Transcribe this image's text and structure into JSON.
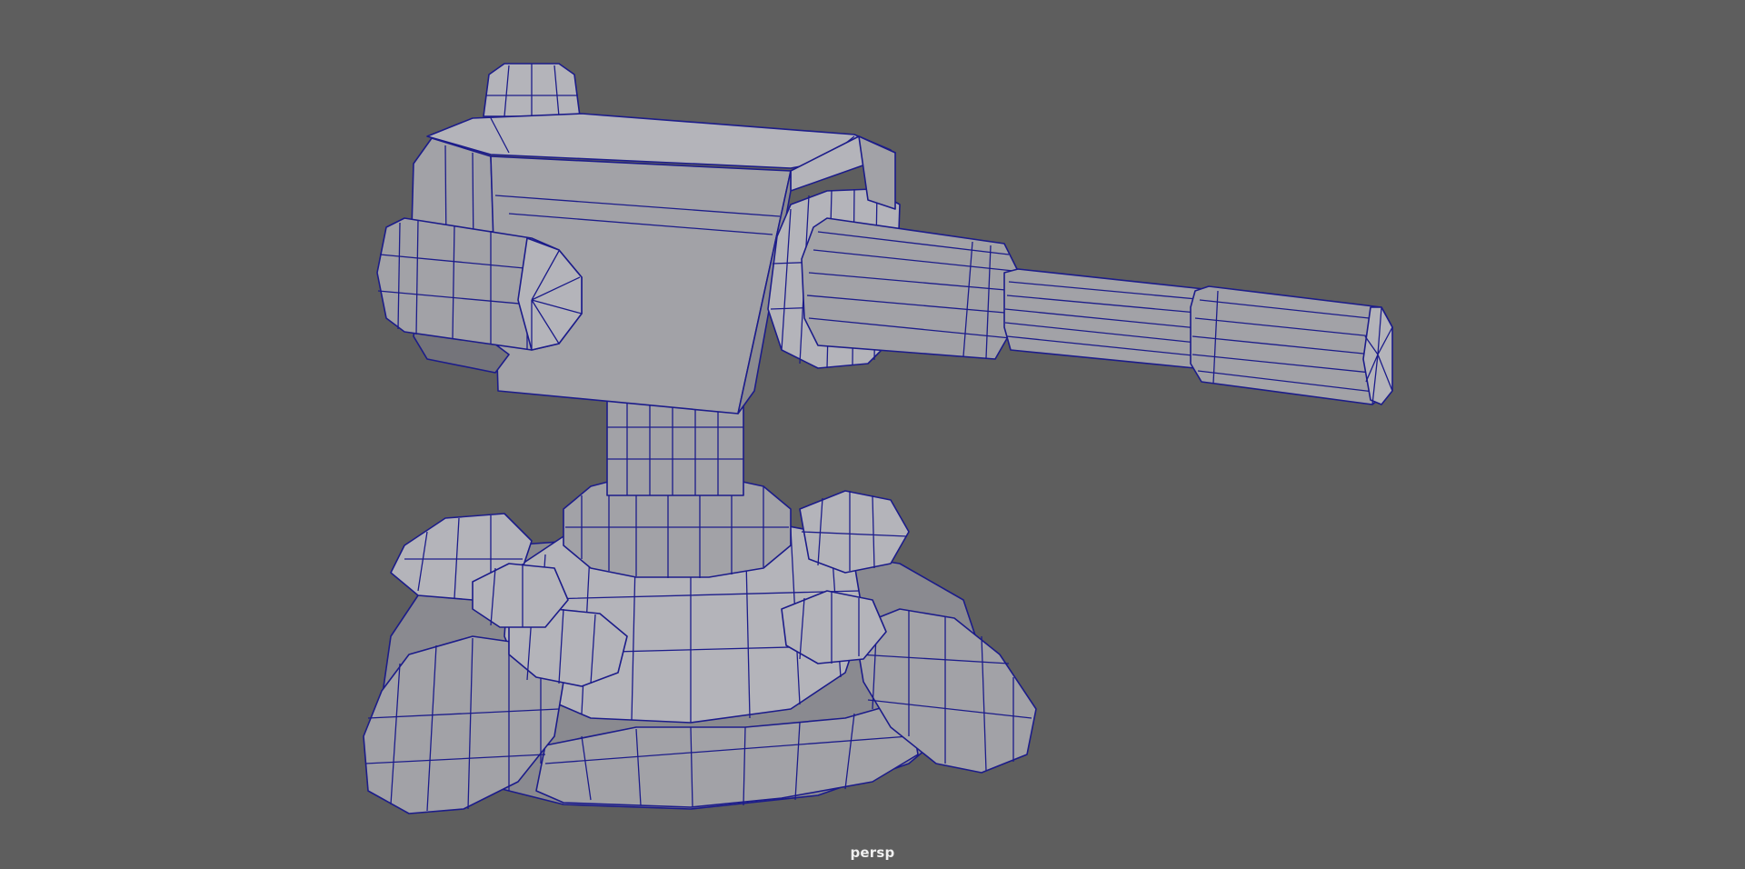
{
  "viewport": {
    "camera_label": "persp",
    "background_color": "#5e5e5e",
    "wireframe_color": "#1c1c8a",
    "shaded_color": "#a2a2a7"
  },
  "model": {
    "icon": "turret-model"
  }
}
